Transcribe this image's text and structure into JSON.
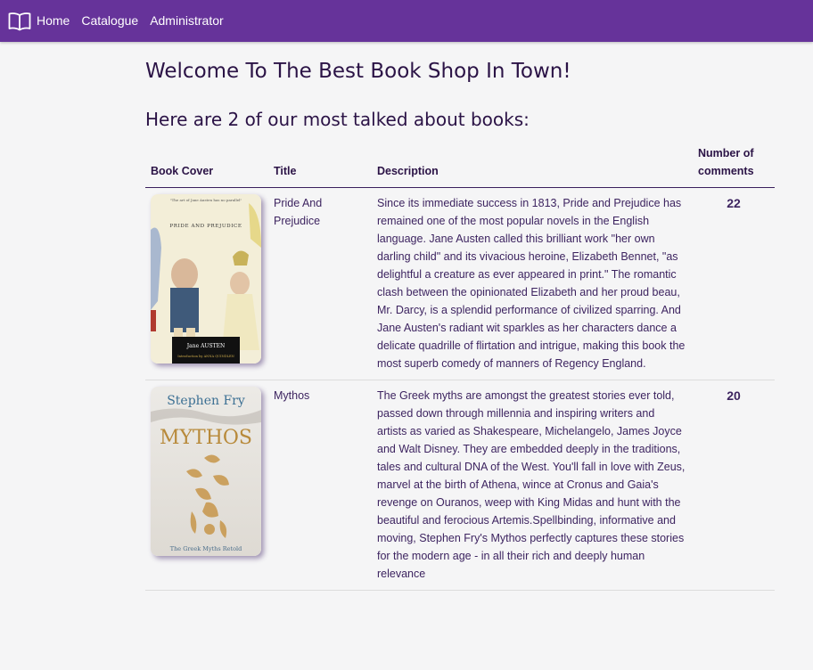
{
  "nav": {
    "brand_icon": "open-book-icon",
    "links": [
      "Home",
      "Catalogue",
      "Administrator"
    ]
  },
  "page": {
    "welcome": "Welcome To The Best Book Shop In Town!",
    "subtitle": "Here are 2 of our most talked about books:"
  },
  "table": {
    "headers": {
      "cover": "Book Cover",
      "title": "Title",
      "description": "Description",
      "comments": "Number of comments"
    },
    "rows": [
      {
        "title": "Pride And Prejudice",
        "description": "Since its immediate success in 1813, Pride and Prejudice has remained one of the most popular novels in the English language. Jane Austen called this brilliant work \"her own darling child\" and its vivacious heroine, Elizabeth Bennet, \"as delightful a creature as ever appeared in print.\" The romantic clash between the opinionated Elizabeth and her proud beau, Mr. Darcy, is a splendid performance of civilized sparring. And Jane Austen's radiant wit sparkles as her characters dance a delicate quadrille of flirtation and intrigue, making this book the most superb comedy of manners of Regency England.",
        "comments": "22",
        "cover": {
          "title_text": "PRIDE AND PREJUDICE",
          "author_text": "Jane AUSTEN",
          "intro_text": "Introduction by ANNA QUINDLEN",
          "quote_text": "\"The art of Jane Austen has no parallel\""
        }
      },
      {
        "title": "Mythos",
        "description": "The Greek myths are amongst the greatest stories ever told, passed down through millennia and inspiring writers and artists as varied as Shakespeare, Michelangelo, James Joyce and Walt Disney. They are embedded deeply in the traditions, tales and cultural DNA of the West. You'll fall in love with Zeus, marvel at the birth of Athena, wince at Cronus and Gaia's revenge on Ouranos, weep with King Midas and hunt with the beautiful and ferocious Artemis.Spellbinding, informative and moving, Stephen Fry's Mythos perfectly captures these stories for the modern age - in all their rich and deeply human relevance",
        "comments": "20",
        "cover": {
          "author_text": "Stephen Fry",
          "title_text": "MYTHOS",
          "tagline_text": "The Greek Myths Retold"
        }
      }
    ]
  },
  "colors": {
    "navbar": "#66339a",
    "heading": "#2b1346",
    "text": "#3d2460",
    "background": "#f5f5f6"
  }
}
